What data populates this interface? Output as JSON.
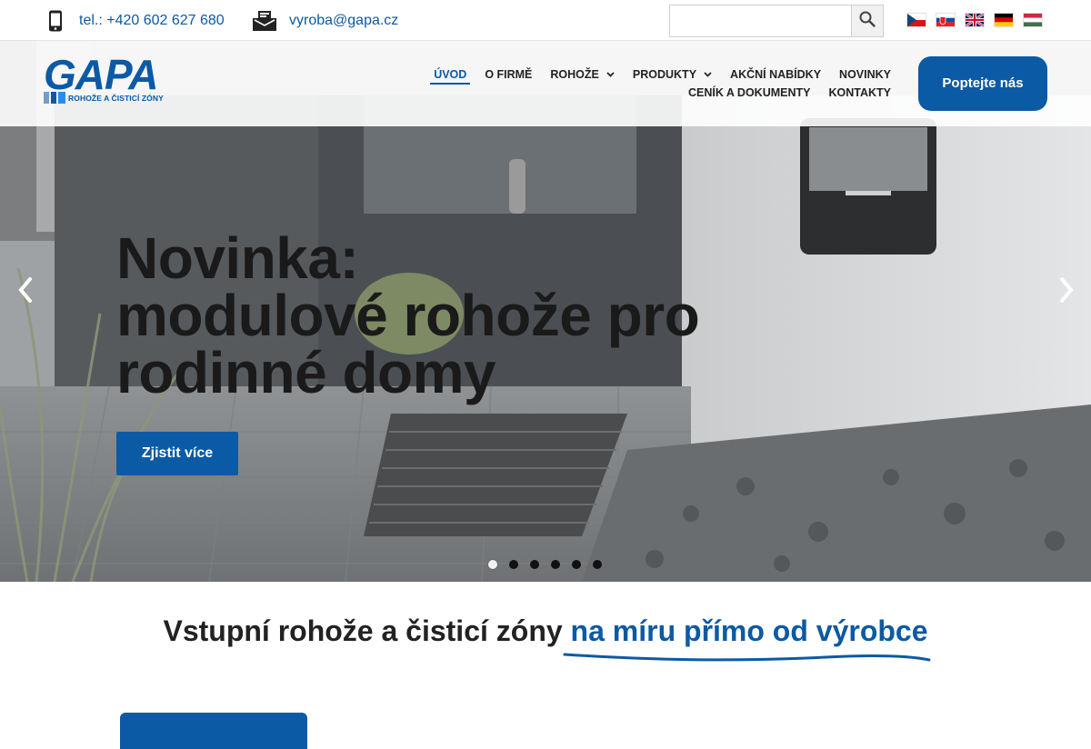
{
  "topbar": {
    "phone": "tel.: +420 602 627 680",
    "email": "vyroba@gapa.cz",
    "search": {
      "placeholder": "",
      "button_icon": "search-icon"
    },
    "languages": [
      "cs",
      "sk",
      "en",
      "de",
      "hu"
    ]
  },
  "logo": {
    "word": "GAPA",
    "tagline": "ROHOŽE A ČISTICÍ ZÓNY"
  },
  "nav": {
    "items": [
      {
        "label": "ÚVOD",
        "active": true,
        "dropdown": false
      },
      {
        "label": "O FIRMĚ",
        "active": false,
        "dropdown": false
      },
      {
        "label": "ROHOŽE",
        "active": false,
        "dropdown": true
      },
      {
        "label": "PRODUKTY",
        "active": false,
        "dropdown": true
      },
      {
        "label": "AKČNÍ NABÍDKY",
        "active": false,
        "dropdown": false
      },
      {
        "label": "NOVINKY",
        "active": false,
        "dropdown": false
      },
      {
        "label": "CENÍK A DOKUMENTY",
        "active": false,
        "dropdown": false
      },
      {
        "label": "KONTAKTY",
        "active": false,
        "dropdown": false
      }
    ],
    "cta": "Poptejte nás"
  },
  "hero": {
    "title_lines": [
      "Novinka:",
      "modulové rohože pro",
      "rodinné domy"
    ],
    "button": "Zjistit více",
    "slides_count": 6,
    "active_slide": 1
  },
  "section": {
    "heading_part1": "Vstupní rohože a čisticí zóny ",
    "heading_accent": "na míru přímo od výrobce"
  },
  "colors": {
    "brand": "#0b5aa5",
    "text": "#222222"
  }
}
